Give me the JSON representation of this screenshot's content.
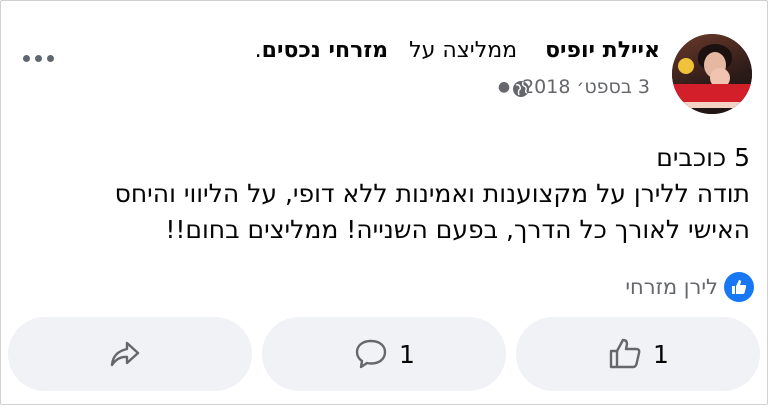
{
  "post": {
    "author_name": "איילת יופיס",
    "recommends_text": "ממליצה על",
    "page_name": "מזרחי נכסים",
    "period": ".",
    "date": "3 בספט׳ 2018",
    "stars_text": "5 כוכבים",
    "body_line_1": "תודה ללירן על מקצוענות ואמינות ללא דופי, על הליווי והיחס",
    "body_line_2": "האישי לאורך כל הדרך, בפעם השנייה! ממליצים בחום!!",
    "reply_author": "לירן מזרחי"
  },
  "icons": {
    "globe": "globe-icon",
    "more": "more-options-icon",
    "like_badge": "thumbs-up-badge-icon",
    "share": "share-icon",
    "comment": "comment-icon",
    "like": "like-icon"
  },
  "actions": {
    "share_count": "",
    "comment_count": "1",
    "like_count": "1"
  },
  "colors": {
    "accent": "#1877f2",
    "secondary_text": "#65676b",
    "button_bg": "#f0f2f5"
  }
}
